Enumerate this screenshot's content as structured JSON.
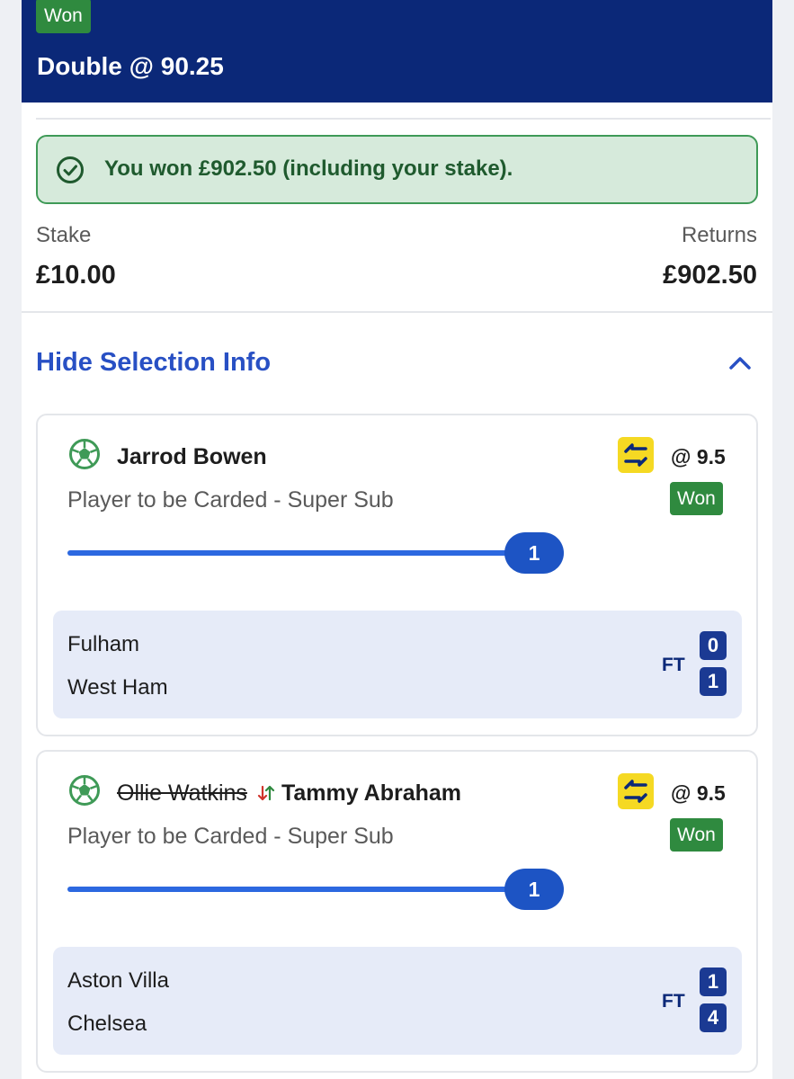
{
  "header": {
    "status": "Won",
    "title": "Double @ 90.25"
  },
  "banner": {
    "text": "You won £902.50 (including your stake).",
    "icon": "check-circle-icon"
  },
  "summary": {
    "stake_label": "Stake",
    "stake_value": "£10.00",
    "returns_label": "Returns",
    "returns_value": "£902.50"
  },
  "toggle": {
    "label": "Hide Selection Info",
    "icon": "chevron-up-icon"
  },
  "selections": [
    {
      "player": "Jarrod Bowen",
      "odds": "@ 9.5",
      "status": "Won",
      "market": "Player to be Carded - Super Sub",
      "progress": "1",
      "home_team": "Fulham",
      "away_team": "West Ham",
      "period": "FT",
      "home_score": "0",
      "away_score": "1"
    },
    {
      "original_player": "Ollie Watkins",
      "player": "Tammy Abraham",
      "odds": "@ 9.5",
      "status": "Won",
      "market": "Player to be Carded - Super Sub",
      "progress": "1",
      "home_team": "Aston Villa",
      "away_team": "Chelsea",
      "period": "FT",
      "home_score": "1",
      "away_score": "4"
    }
  ],
  "colors": {
    "header_bg": "#0b2878",
    "won_green": "#2f8a3f",
    "banner_bg": "#d6eadb",
    "link_blue": "#2850c4",
    "boost_yellow": "#f5d923"
  }
}
